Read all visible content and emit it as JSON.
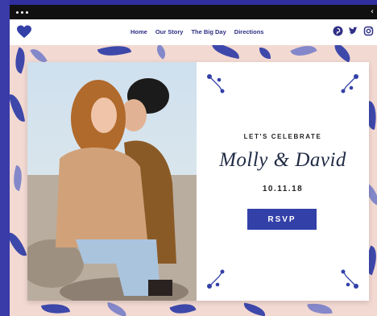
{
  "nav": {
    "links": [
      "Home",
      "Our Story",
      "The Big Day",
      "Directions"
    ],
    "social_icons": [
      "pinterest-icon",
      "twitter-icon",
      "instagram-icon"
    ]
  },
  "invite": {
    "eyebrow": "LET'S CELEBRATE",
    "names": "Molly & David",
    "date": "10.11.18",
    "rsvp_label": "RSVP"
  },
  "colors": {
    "accent": "#3340a8",
    "nav_text": "#2f2f86",
    "pattern_bg": "#f2d9d2",
    "chrome": "#111111"
  }
}
